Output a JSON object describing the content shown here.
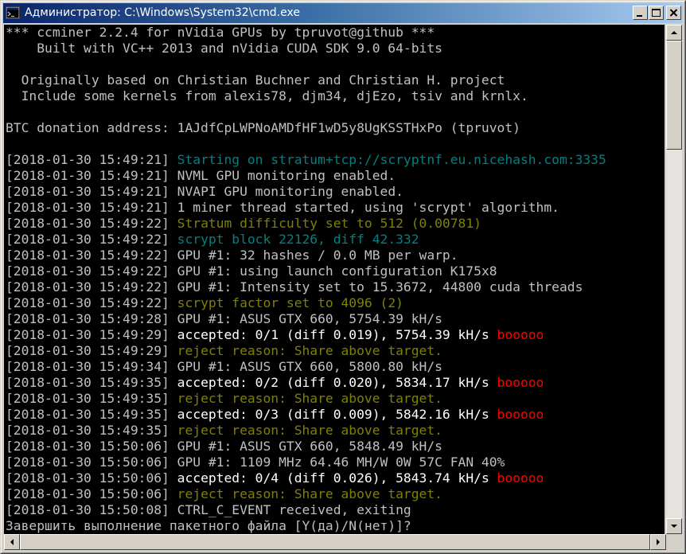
{
  "window": {
    "title": "Администратор: C:\\Windows\\System32\\cmd.exe",
    "icon": "cmd-icon"
  },
  "controls": {
    "minimize_icon": "minimize-icon",
    "maximize_icon": "maximize-icon",
    "close_icon": "close-icon"
  },
  "colors": {
    "titlebar_start": "#0a246a",
    "titlebar_end": "#a6caf0",
    "console_bg": "#000000",
    "text_default": "#c0c0c0",
    "text_cyan": "#008080",
    "text_olive": "#808000",
    "text_white": "#ffffff",
    "text_red": "#ff0000"
  },
  "console": {
    "lines": [
      [
        {
          "text": "*** ccminer 2.2.4 for nVidia GPUs by tpruvot@github ***",
          "c": "grey"
        }
      ],
      [
        {
          "text": "    Built with VC++ 2013 and nVidia CUDA SDK 9.0 64-bits",
          "c": "grey"
        }
      ],
      [],
      [
        {
          "text": "  Originally based on Christian Buchner and Christian H. project",
          "c": "grey"
        }
      ],
      [
        {
          "text": "  Include some kernels from alexis78, djm34, djEzo, tsiv and krnlx.",
          "c": "grey"
        }
      ],
      [],
      [
        {
          "text": "BTC donation address: 1AJdfCpLWPNoAMDfHF1wD5y8UgKSSTHxPo (tpruvot)",
          "c": "grey"
        }
      ],
      [],
      [
        {
          "text": "[2018-01-30 15:49:21] ",
          "c": "grey"
        },
        {
          "text": "Starting on stratum+tcp://scryptnf.eu.nicehash.com:3335",
          "c": "cyan"
        }
      ],
      [
        {
          "text": "[2018-01-30 15:49:21] ",
          "c": "grey"
        },
        {
          "text": "NVML GPU monitoring enabled.",
          "c": "grey"
        }
      ],
      [
        {
          "text": "[2018-01-30 15:49:21] ",
          "c": "grey"
        },
        {
          "text": "NVAPI GPU monitoring enabled.",
          "c": "grey"
        }
      ],
      [
        {
          "text": "[2018-01-30 15:49:21] ",
          "c": "grey"
        },
        {
          "text": "1 miner thread started, using 'scrypt' algorithm.",
          "c": "grey"
        }
      ],
      [
        {
          "text": "[2018-01-30 15:49:22] ",
          "c": "grey"
        },
        {
          "text": "Stratum difficulty set to 512 (0.00781)",
          "c": "olive"
        }
      ],
      [
        {
          "text": "[2018-01-30 15:49:22] ",
          "c": "grey"
        },
        {
          "text": "scrypt block 22126, diff 42.332",
          "c": "cyan"
        }
      ],
      [
        {
          "text": "[2018-01-30 15:49:22] ",
          "c": "grey"
        },
        {
          "text": "GPU #1: 32 hashes / 0.0 MB per warp.",
          "c": "grey"
        }
      ],
      [
        {
          "text": "[2018-01-30 15:49:22] ",
          "c": "grey"
        },
        {
          "text": "GPU #1: using launch configuration K175x8",
          "c": "grey"
        }
      ],
      [
        {
          "text": "[2018-01-30 15:49:22] ",
          "c": "grey"
        },
        {
          "text": "GPU #1: Intensity set to 15.3672, 44800 cuda threads",
          "c": "grey"
        }
      ],
      [
        {
          "text": "[2018-01-30 15:49:22] ",
          "c": "grey"
        },
        {
          "text": "scrypt factor set to 4096 (2)",
          "c": "olive"
        }
      ],
      [
        {
          "text": "[2018-01-30 15:49:28] ",
          "c": "grey"
        },
        {
          "text": "GPU #1: ASUS GTX 660, 5754.39 kH/s",
          "c": "grey"
        }
      ],
      [
        {
          "text": "[2018-01-30 15:49:29] ",
          "c": "grey"
        },
        {
          "text": "accepted: 0/1 (diff 0.019), 5754.39 kH/s ",
          "c": "white"
        },
        {
          "text": "booooo",
          "c": "red"
        }
      ],
      [
        {
          "text": "[2018-01-30 15:49:29] ",
          "c": "grey"
        },
        {
          "text": "reject reason: Share above target.",
          "c": "olive"
        }
      ],
      [
        {
          "text": "[2018-01-30 15:49:34] ",
          "c": "grey"
        },
        {
          "text": "GPU #1: ASUS GTX 660, 5800.80 kH/s",
          "c": "grey"
        }
      ],
      [
        {
          "text": "[2018-01-30 15:49:35] ",
          "c": "grey"
        },
        {
          "text": "accepted: 0/2 (diff 0.020), 5834.17 kH/s ",
          "c": "white"
        },
        {
          "text": "booooo",
          "c": "red"
        }
      ],
      [
        {
          "text": "[2018-01-30 15:49:35] ",
          "c": "grey"
        },
        {
          "text": "reject reason: Share above target.",
          "c": "olive"
        }
      ],
      [
        {
          "text": "[2018-01-30 15:49:35] ",
          "c": "grey"
        },
        {
          "text": "accepted: 0/3 (diff 0.009), 5842.16 kH/s ",
          "c": "white"
        },
        {
          "text": "booooo",
          "c": "red"
        }
      ],
      [
        {
          "text": "[2018-01-30 15:49:35] ",
          "c": "grey"
        },
        {
          "text": "reject reason: Share above target.",
          "c": "olive"
        }
      ],
      [
        {
          "text": "[2018-01-30 15:50:06] ",
          "c": "grey"
        },
        {
          "text": "GPU #1: ASUS GTX 660, 5848.49 kH/s",
          "c": "grey"
        }
      ],
      [
        {
          "text": "[2018-01-30 15:50:06] ",
          "c": "grey"
        },
        {
          "text": "GPU #1: 1109 MHz 64.46 MH/W 0W 57C FAN 40%",
          "c": "grey"
        }
      ],
      [
        {
          "text": "[2018-01-30 15:50:06] ",
          "c": "grey"
        },
        {
          "text": "accepted: 0/4 (diff 0.026), 5843.74 kH/s ",
          "c": "white"
        },
        {
          "text": "booooo",
          "c": "red"
        }
      ],
      [
        {
          "text": "[2018-01-30 15:50:06] ",
          "c": "grey"
        },
        {
          "text": "reject reason: Share above target.",
          "c": "olive"
        }
      ],
      [
        {
          "text": "[2018-01-30 15:50:08] ",
          "c": "grey"
        },
        {
          "text": "CTRL_C_EVENT received, exiting",
          "c": "grey"
        }
      ],
      [
        {
          "text": "Завершить выполнение пакетного файла [Y(да)/N(нет)]?",
          "c": "grey"
        }
      ]
    ]
  },
  "scrollbars": {
    "up_icon": "scroll-up-arrow-icon",
    "down_icon": "scroll-down-arrow-icon",
    "left_icon": "scroll-left-arrow-icon",
    "right_icon": "scroll-right-arrow-icon"
  }
}
